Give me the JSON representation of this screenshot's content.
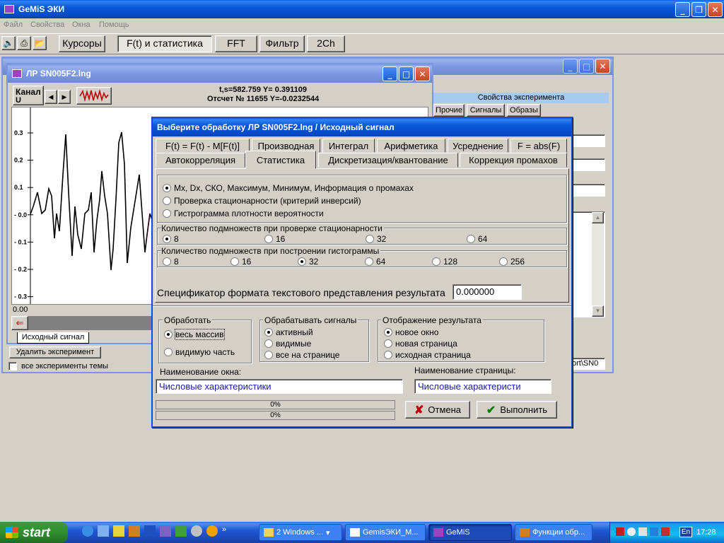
{
  "app": {
    "title": "GeMiS ЭКИ",
    "menu": [
      "Файл",
      "Свойства",
      "Окна",
      "Помощь"
    ],
    "toolbar_buttons": [
      "Курсоры",
      "F(t) и статистика",
      "FFT",
      "Фильтр",
      "2Ch"
    ]
  },
  "chart_window": {
    "title": "ЛР SN005F2.lng",
    "channel_label": "Канал",
    "channel_value": "U",
    "cursor_line1": "t,s=582.759  Y= 0.391109",
    "cursor_line2": "Отсчет № 11655 Y=-0.0232544",
    "x_value": "0.00",
    "tab_label": "Исходный сигнал"
  },
  "chart_data": {
    "type": "line",
    "yticks": [
      "0.3",
      "0.2",
      "0.1",
      "- 0.0",
      "- 0.1",
      "- 0.2",
      "- 0.3"
    ]
  },
  "right_window": {
    "section": "Свойства эксперимента",
    "tabs": [
      "Прочие",
      "Сигналы",
      "Образы"
    ],
    "status_text": "ort\\SN0"
  },
  "left_panel": {
    "delete_button": "Удалить эксперимент",
    "all_experiments": "все эксперименты темы"
  },
  "dialog": {
    "title": "Выберите  обработку  ЛР SN005F2.lng / Исходный сигнал",
    "tabs_row1": [
      "F(t) = F(t) - M[F(t)]",
      "Производная",
      "Интеграл",
      "Арифметика",
      "Усреднение",
      "F = abs(F)"
    ],
    "tabs_row2": [
      "Автокорреляция",
      "Статистика",
      "Дискретизация/квантование",
      "Коррекция промахов"
    ],
    "options": [
      "Mx, Dx, СКО, Максимум, Минимум, Информация о промахах",
      "Проверка стационарности (критерий инверсий)",
      "Гистрограмма плотности вероятности"
    ],
    "subsets_stationarity_label": "Количество подмножеств при проверке стационарности",
    "subsets_stationarity": [
      "8",
      "16",
      "32",
      "64"
    ],
    "subsets_histogram_label": "Количество подмножеств при построении гистограммы",
    "subsets_histogram": [
      "8",
      "16",
      "32",
      "64",
      "128",
      "256"
    ],
    "format_label": "Спецификатор формата текстового представления результата",
    "format_value": "0.000000",
    "process_group": "Обработать",
    "process_options": [
      "весь массив",
      "видимую часть"
    ],
    "signals_group": "Обрабатывать сигналы",
    "signals_options": [
      "активный",
      "видимые",
      "все на странице"
    ],
    "display_group": "Отображение результата",
    "display_options": [
      "новое окно",
      "новая страница",
      "исходная страница"
    ],
    "window_name_label": "Наименование окна:",
    "window_name_value": "Числовые характеристики",
    "page_name_label": "Наименование страницы:",
    "page_name_value": "Числовые характеристи",
    "progress1": "0%",
    "progress2": "0%",
    "cancel_label": "Отмена",
    "ok_label": "Выполнить"
  },
  "taskbar": {
    "start": "start",
    "tasks": [
      "2 Windows ...",
      "GemisЭКИ_М...",
      "GeMiS",
      "Функции обр..."
    ],
    "lang": "En",
    "clock": "17:28"
  }
}
